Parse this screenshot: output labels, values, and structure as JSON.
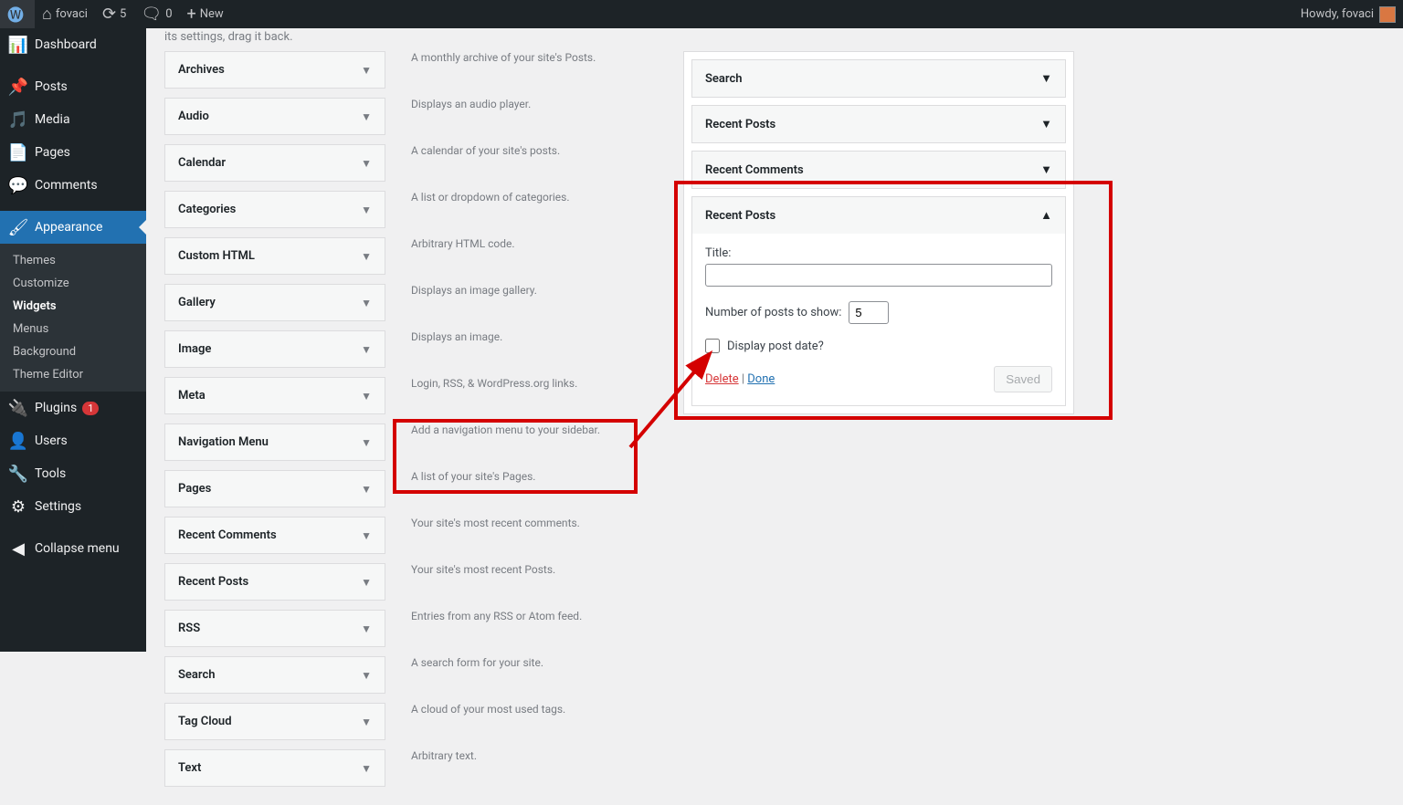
{
  "adminbar": {
    "site_name": "fovaci",
    "updates_count": "5",
    "comments_count": "0",
    "new_label": "New",
    "howdy": "Howdy, fovaci"
  },
  "sidebar": {
    "dashboard": "Dashboard",
    "posts": "Posts",
    "media": "Media",
    "pages": "Pages",
    "comments": "Comments",
    "appearance": "Appearance",
    "appearance_sub": {
      "themes": "Themes",
      "customize": "Customize",
      "widgets": "Widgets",
      "menus": "Menus",
      "background": "Background",
      "theme_editor": "Theme Editor"
    },
    "plugins": "Plugins",
    "plugins_badge": "1",
    "users": "Users",
    "tools": "Tools",
    "settings": "Settings",
    "collapse": "Collapse menu"
  },
  "main": {
    "intro_clip": "its settings, drag it back.",
    "available": [
      {
        "title": "Archives",
        "desc": "A monthly archive of your site's Posts."
      },
      {
        "title": "Audio",
        "desc": "Displays an audio player."
      },
      {
        "title": "Calendar",
        "desc": "A calendar of your site's posts."
      },
      {
        "title": "Categories",
        "desc": "A list or dropdown of categories."
      },
      {
        "title": "Custom HTML",
        "desc": "Arbitrary HTML code."
      },
      {
        "title": "Gallery",
        "desc": "Displays an image gallery."
      },
      {
        "title": "Image",
        "desc": "Displays an image."
      },
      {
        "title": "Meta",
        "desc": "Login, RSS, & WordPress.org links."
      },
      {
        "title": "Navigation Menu",
        "desc": "Add a navigation menu to your sidebar."
      },
      {
        "title": "Pages",
        "desc": "A list of your site's Pages."
      },
      {
        "title": "Recent Comments",
        "desc": "Your site's most recent comments."
      },
      {
        "title": "Recent Posts",
        "desc": "Your site's most recent Posts."
      },
      {
        "title": "RSS",
        "desc": "Entries from any RSS or Atom feed."
      },
      {
        "title": "Search",
        "desc": "A search form for your site."
      },
      {
        "title": "Tag Cloud",
        "desc": "A cloud of your most used tags."
      },
      {
        "title": "Text",
        "desc": "Arbitrary text."
      }
    ],
    "dropzone": {
      "closed": [
        "Search",
        "Recent Posts",
        "Recent Comments"
      ],
      "open": {
        "heading": "Recent Posts",
        "title_label": "Title:",
        "title_value": "",
        "num_label": "Number of posts to show:",
        "num_value": "5",
        "display_date_label": "Display post date?",
        "delete": "Delete",
        "sep": " | ",
        "done": "Done",
        "saved": "Saved"
      }
    }
  }
}
